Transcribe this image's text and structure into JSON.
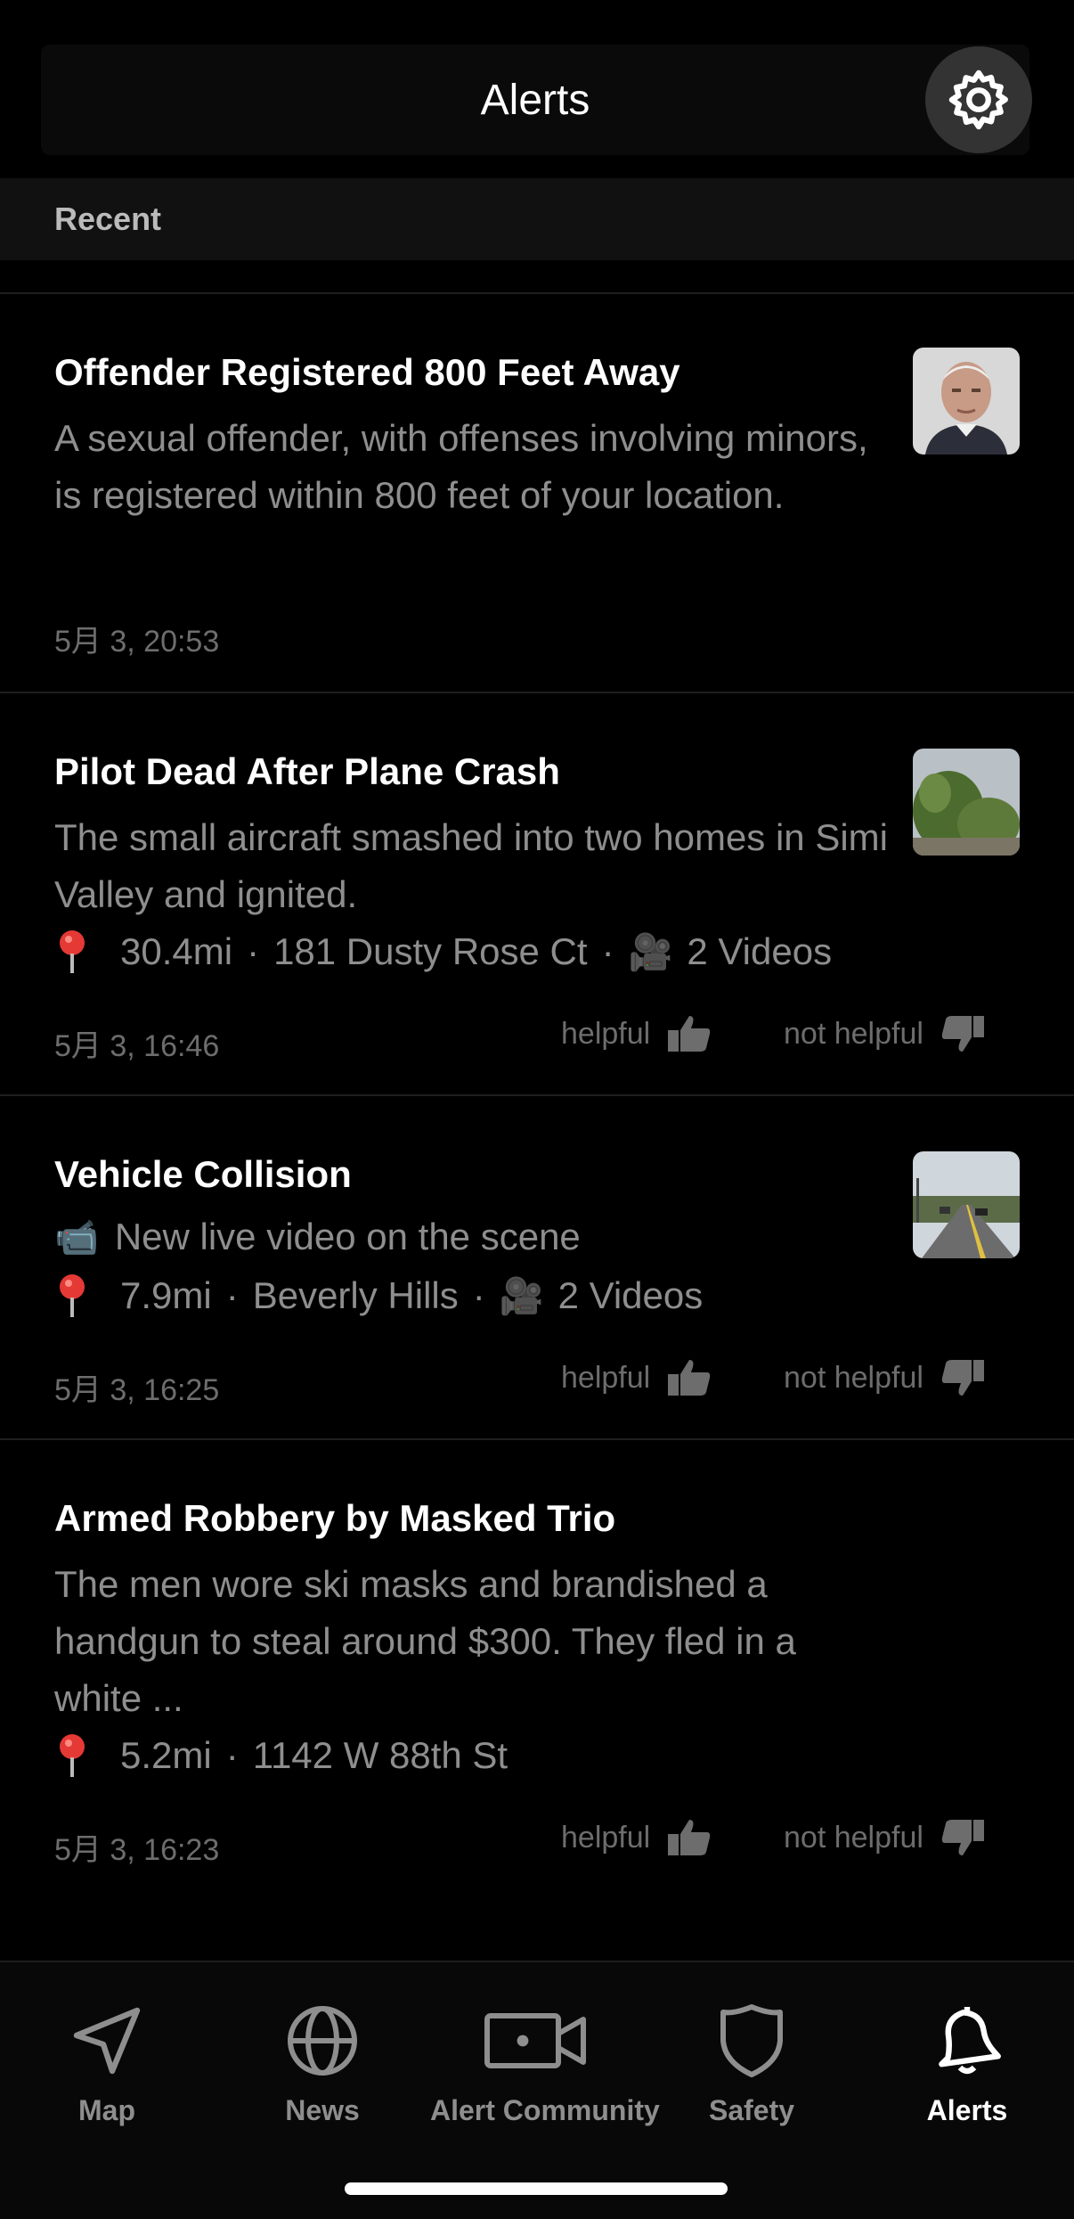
{
  "header": {
    "title": "Alerts"
  },
  "section": {
    "label": "Recent"
  },
  "alerts": [
    {
      "title": "Offender Registered 800 Feet Away",
      "description": "A sexual offender, with offenses involving minors, is registered within 800 feet of your location.",
      "time": "5月 3, 20:53"
    },
    {
      "title": "Pilot Dead After Plane Crash",
      "description": "The small aircraft smashed into two homes in Simi Valley and ignited.",
      "distance": "30.4mi",
      "location": "181 Dusty Rose Ct",
      "videos": "2 Videos",
      "time": "5月 3, 16:46",
      "helpful": "helpful",
      "not_helpful": "not helpful"
    },
    {
      "title": "Vehicle Collision",
      "live_text": "New live video on the scene",
      "distance": "7.9mi",
      "location": "Beverly Hills",
      "videos": "2 Videos",
      "time": "5月 3, 16:25",
      "helpful": "helpful",
      "not_helpful": "not helpful"
    },
    {
      "title": "Armed Robbery by Masked Trio",
      "description": "The men wore ski masks and brandished a handgun to steal around $300. They fled in a white ...",
      "distance": "5.2mi",
      "location": "1142 W 88th St",
      "time": "5月 3, 16:23",
      "helpful": "helpful",
      "not_helpful": "not helpful"
    }
  ],
  "tabs": [
    {
      "label": "Map",
      "icon": "navigation-arrow-icon"
    },
    {
      "label": "News",
      "icon": "globe-icon"
    },
    {
      "label": "Alert Community",
      "icon": "video-camera-icon"
    },
    {
      "label": "Safety",
      "icon": "shield-icon"
    },
    {
      "label": "Alerts",
      "icon": "bell-icon",
      "active": true
    }
  ],
  "colors": {
    "background": "#000000",
    "text_primary": "#ffffff",
    "text_secondary": "#8e8e8e",
    "pin": "#e53935"
  }
}
